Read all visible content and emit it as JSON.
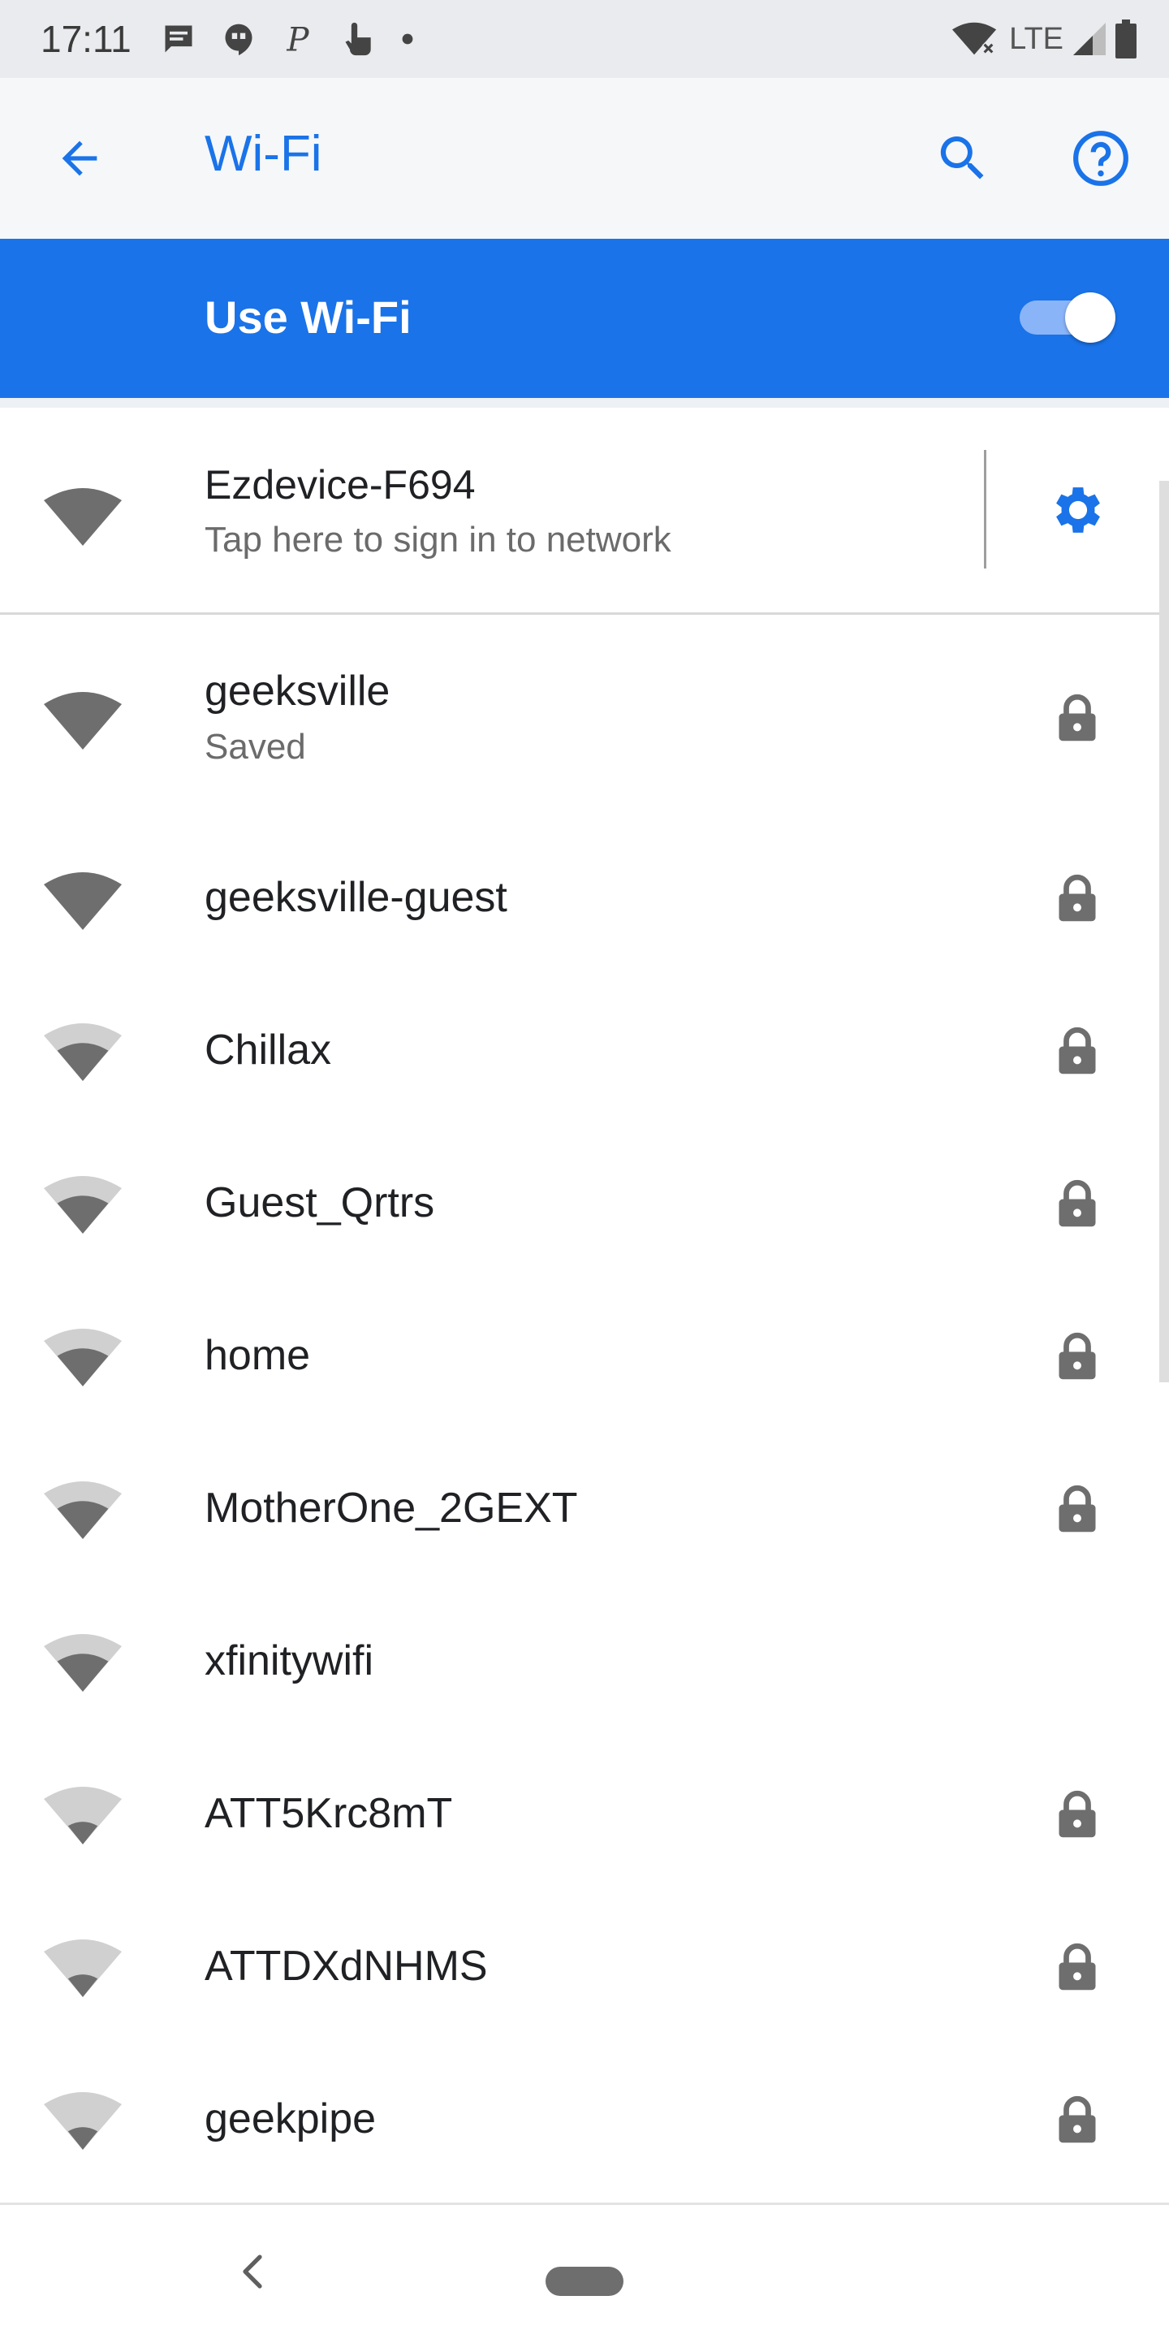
{
  "status_bar": {
    "time": "17:11",
    "left_icons": [
      "message-icon",
      "hangouts-icon",
      "pinterest-icon",
      "touch-icon",
      "dot-icon"
    ],
    "lte": "LTE",
    "right_icons": [
      "wifi-off-icon",
      "signal-icon",
      "battery-icon"
    ]
  },
  "app_bar": {
    "title": "Wi-Fi",
    "icons": [
      "back-arrow-icon",
      "search-icon",
      "help-icon"
    ]
  },
  "master_switch": {
    "label": "Use Wi-Fi",
    "on": true
  },
  "current_network": {
    "name": "Ezdevice-F694",
    "status": "Tap here to sign in to network",
    "icons": [
      "wifi-full-icon",
      "gear-icon"
    ]
  },
  "networks": [
    {
      "name": "geeksville",
      "status": "Saved",
      "secured": true,
      "signal": 4
    },
    {
      "name": "geeksville-guest",
      "secured": true,
      "signal": 4
    },
    {
      "name": "Chillax",
      "secured": true,
      "signal": 2
    },
    {
      "name": "Guest_Qrtrs",
      "secured": true,
      "signal": 2
    },
    {
      "name": "home",
      "secured": true,
      "signal": 2
    },
    {
      "name": "MotherOne_2GEXT",
      "secured": true,
      "signal": 2
    },
    {
      "name": "xfinitywifi",
      "secured": false,
      "signal": 2
    },
    {
      "name": "ATT5Krc8mT",
      "secured": true,
      "signal": 1
    },
    {
      "name": "ATTDXdNHMS",
      "secured": true,
      "signal": 1
    },
    {
      "name": "geekpipe",
      "secured": true,
      "signal": 1
    }
  ],
  "colors": {
    "accent": "#1a73e8",
    "status_bar_bg": "#e9ebee",
    "app_bar_bg": "#f5f7f9",
    "icon_dark": "#6e6e6e",
    "icon_light": "#d0d0d0"
  },
  "nav_bar": {
    "icons": [
      "nav-back-icon",
      "home-pill-icon"
    ]
  }
}
